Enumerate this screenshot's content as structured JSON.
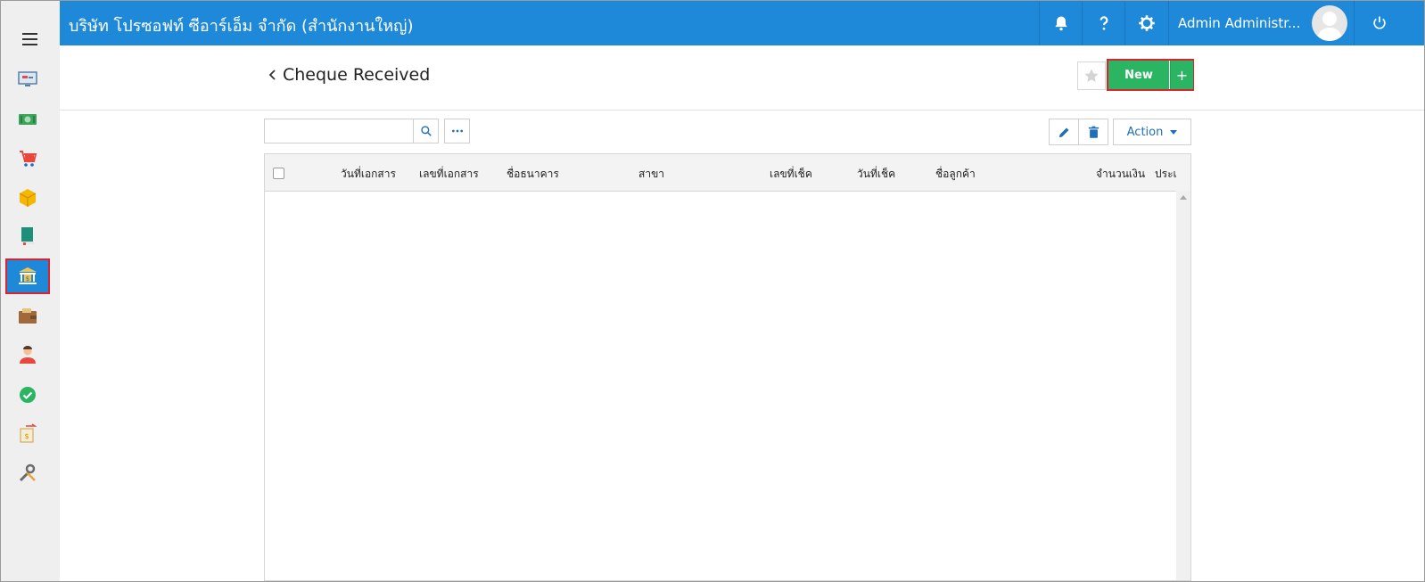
{
  "header": {
    "company": "บริษัท โปรซอฟท์ ซีอาร์เอ็ม จำกัด (สำนักงานใหญ่)",
    "user_name": "Admin Administr...",
    "brand_color": "#1e88d9"
  },
  "sidebar": {
    "items": [
      {
        "icon": "monitor-icon"
      },
      {
        "icon": "money-icon"
      },
      {
        "icon": "cart-icon"
      },
      {
        "icon": "box-icon"
      },
      {
        "icon": "book-icon"
      },
      {
        "icon": "bank-icon",
        "active": true
      },
      {
        "icon": "wallet-icon"
      },
      {
        "icon": "person-icon"
      },
      {
        "icon": "check-circle-icon"
      },
      {
        "icon": "transfer-icon"
      },
      {
        "icon": "tools-icon"
      }
    ]
  },
  "page": {
    "title": "Cheque Received",
    "new_label": "New",
    "new_plus": "+",
    "action_label": "Action",
    "search_placeholder": "",
    "new_color": "#2bb461"
  },
  "grid": {
    "columns": [
      "วันที่เอกสาร",
      "เลขที่เอกสาร",
      "ชื่อธนาคาร",
      "สาขา",
      "เลขที่เช็ค",
      "วันที่เช็ค",
      "ชื่อลูกค้า",
      "จำนวนเงิน",
      "ประเ"
    ],
    "rows": []
  }
}
